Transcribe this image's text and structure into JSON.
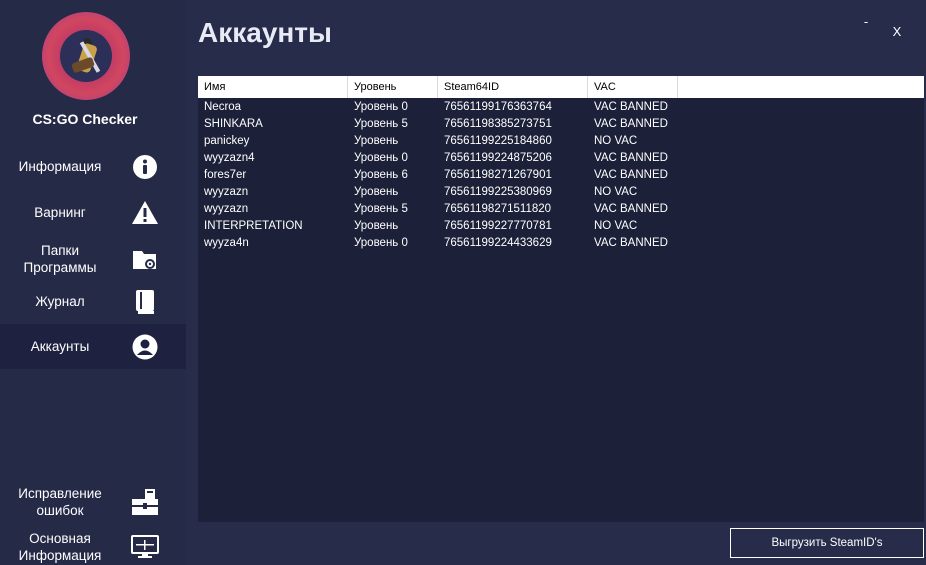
{
  "app": {
    "name": "CS:GO Checker",
    "page_title": "Аккаунты",
    "minimize_label": "-",
    "close_label": "X"
  },
  "sidebar": {
    "items": [
      {
        "label": "Информация",
        "icon": "info-icon",
        "active": false
      },
      {
        "label": "Варнинг",
        "icon": "warning-icon",
        "active": false
      },
      {
        "label": "Папки\nПрограммы",
        "icon": "folder-settings-icon",
        "active": false
      },
      {
        "label": "Журнал",
        "icon": "book-icon",
        "active": false
      },
      {
        "label": "Аккаунты",
        "icon": "user-icon",
        "active": true
      },
      {
        "label": "Исправление\nошибок",
        "icon": "toolbox-icon",
        "active": false
      },
      {
        "label": "Основная\nИнформация",
        "icon": "monitor-icon",
        "active": false
      }
    ]
  },
  "table": {
    "columns": [
      "Имя",
      "Уровень",
      "Steam64ID",
      "VAC"
    ],
    "rows": [
      [
        "Necroa",
        "Уровень 0",
        "76561199176363764",
        "VAC BANNED"
      ],
      [
        "SHINKARA",
        "Уровень 5",
        "76561198385273751",
        "VAC BANNED"
      ],
      [
        "panickey",
        "Уровень",
        "76561199225184860",
        "NO VAC"
      ],
      [
        "wyyzazn4",
        "Уровень 0",
        "76561199224875206",
        "VAC BANNED"
      ],
      [
        "fores7er",
        "Уровень 6",
        "76561198271267901",
        "VAC BANNED"
      ],
      [
        "wyyzazn",
        "Уровень",
        "76561199225380969",
        "NO VAC"
      ],
      [
        "wyyzazn",
        "Уровень 5",
        "76561198271511820",
        "VAC BANNED"
      ],
      [
        "INTERPRETATION",
        "Уровень",
        "76561199227770781",
        "NO VAC"
      ],
      [
        "wyyza4n",
        "Уровень 0",
        "76561199224433629",
        "VAC BANNED"
      ]
    ]
  },
  "footer": {
    "export_label": "Выгрузить SteamID's"
  },
  "colors": {
    "background": "#272c4b",
    "sidebar": "#252a47",
    "active_item": "#1e2240",
    "table_bg": "#1c2038"
  }
}
